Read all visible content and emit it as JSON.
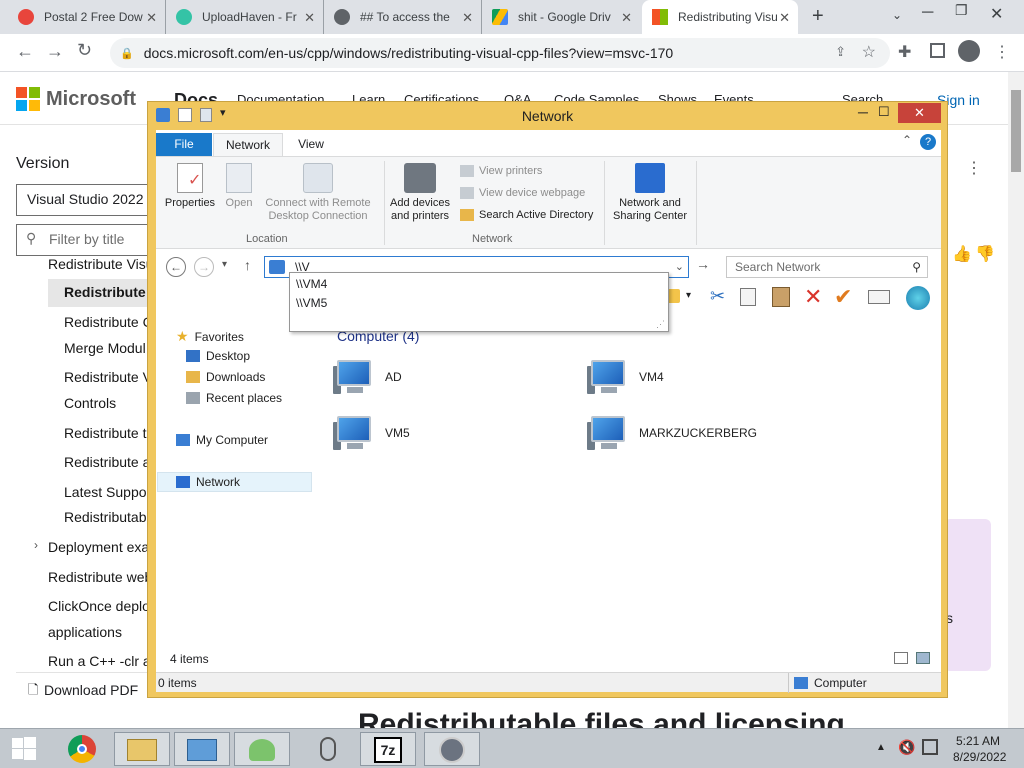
{
  "browser": {
    "tabs": [
      {
        "title": "Postal 2 Free Dow",
        "color": "#e8453c"
      },
      {
        "title": "UploadHaven - Fr",
        "color": "#34c3a6"
      },
      {
        "title": "## To access the",
        "color": "#5f6368"
      },
      {
        "title": "shit - Google Driv",
        "color": "#fbbc04"
      },
      {
        "title": "Redistributing Visu",
        "color": "#f35325"
      }
    ],
    "new_tab": "+",
    "url": "docs.microsoft.com/en-us/cpp/windows/redistributing-visual-cpp-files?view=msvc-170"
  },
  "docs": {
    "brand": "Microsoft",
    "section": "Docs",
    "nav": [
      "Documentation",
      "Learn",
      "Certifications",
      "Q&A",
      "Code Samples",
      "Shows",
      "Events"
    ],
    "search": "Search",
    "signin": "Sign in",
    "version_label": "Version",
    "version_value": "Visual Studio 2022",
    "filter_placeholder": "Filter by title",
    "toc": [
      "Redistribute Visu",
      "Redistribute V",
      "Redistribute C",
      "Merge Modul",
      "Redistribute V",
      "Controls",
      "Redistribute t",
      "Redistribute a",
      "Latest Suppor",
      "Redistributab",
      "Deployment exa",
      "Redistribute web",
      "ClickOnce deplo",
      "applications",
      "Run a C++ -clr a"
    ],
    "download_pdf": "Download PDF",
    "heading": "Redistributable files and licensing",
    "side_letter": "s"
  },
  "explorer": {
    "title": "Network",
    "tabs": [
      "File",
      "Network",
      "View"
    ],
    "ribbon": {
      "properties": "Properties",
      "open": "Open",
      "remote": "Connect with Remote Desktop Connection",
      "location_group": "Location",
      "add_devices": "Add devices and printers",
      "view_printers": "View printers",
      "view_device_webpage": "View device webpage",
      "search_ad": "Search Active Directory",
      "network_group": "Network",
      "network_center": "Network and Sharing Center"
    },
    "address": "\\\\V",
    "search_placeholder": "Search Network",
    "suggestions": [
      "\\\\VM4",
      "\\\\VM5"
    ],
    "nav": {
      "favorites": "Favorites",
      "desktop": "Desktop",
      "downloads": "Downloads",
      "recent": "Recent places",
      "mycomputer": "My Computer",
      "network": "Network"
    },
    "group_header": "Computer (4)",
    "computers": [
      "AD",
      "VM4",
      "VM5",
      "MARKZUCKERBERG"
    ],
    "item_count": "4 items",
    "status_left": "0 items",
    "status_right": "Computer"
  },
  "taskbar": {
    "time": "5:21 AM",
    "date": "8/29/2022",
    "app_7z": "7z"
  }
}
